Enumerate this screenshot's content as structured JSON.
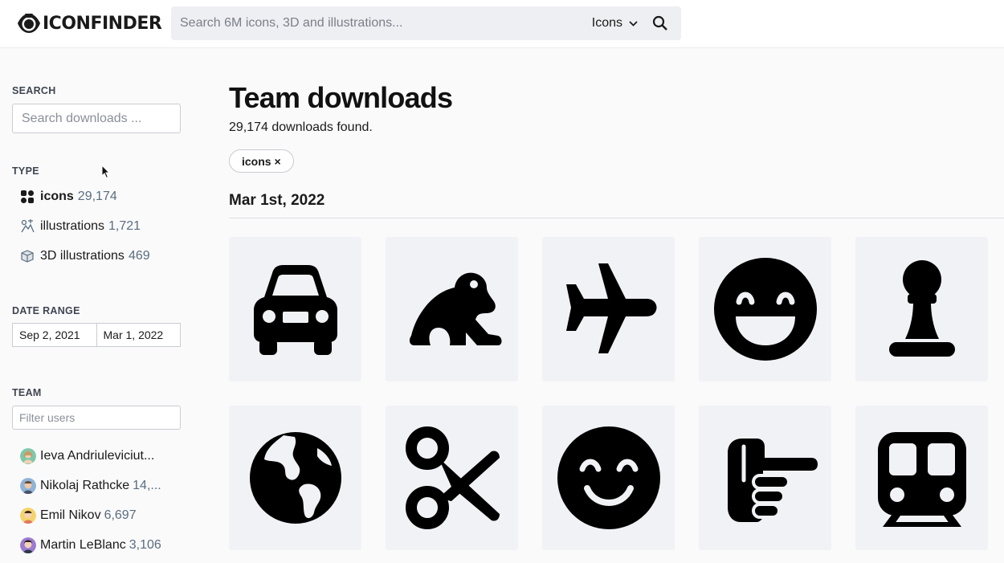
{
  "header": {
    "logo_text": "ICONFINDER",
    "search_placeholder": "Search 6M icons, 3D and illustrations...",
    "type_select": "Icons"
  },
  "sidebar": {
    "search_label": "SEARCH",
    "search_placeholder": "Search downloads ...",
    "type_label": "TYPE",
    "types": [
      {
        "label": "icons",
        "count": "29,174",
        "icon": "grid-icon"
      },
      {
        "label": "illustrations",
        "count": "1,721",
        "icon": "illustration-icon"
      },
      {
        "label": "3D illustrations",
        "count": "469",
        "icon": "cube-icon"
      }
    ],
    "date_range_label": "DATE RANGE",
    "date_from": "Sep 2, 2021",
    "date_to": "Mar 1, 2022",
    "team_label": "TEAM",
    "team_filter_placeholder": "Filter users",
    "users": [
      {
        "name": "Ieva Andriuleviciut...",
        "count": ""
      },
      {
        "name": "Nikolaj Rathcke",
        "count": "14,..."
      },
      {
        "name": "Emil Nikov",
        "count": "6,697"
      },
      {
        "name": "Martin LeBlanc",
        "count": "3,106"
      }
    ]
  },
  "main": {
    "title": "Team downloads",
    "found_text": "29,174 downloads found.",
    "filter_chip": "icons ×",
    "date_heading": "Mar 1st, 2022",
    "icons": [
      "car-icon",
      "frog-icon",
      "plane-icon",
      "grin-face-icon",
      "chess-pawn-icon",
      "globe-icon",
      "scissors-icon",
      "smile-face-icon",
      "pointing-hand-icon",
      "train-icon"
    ]
  },
  "colors": {
    "accent_count": "#5a6d7f",
    "background": "#fafafb",
    "tile": "#f1f2f5"
  }
}
